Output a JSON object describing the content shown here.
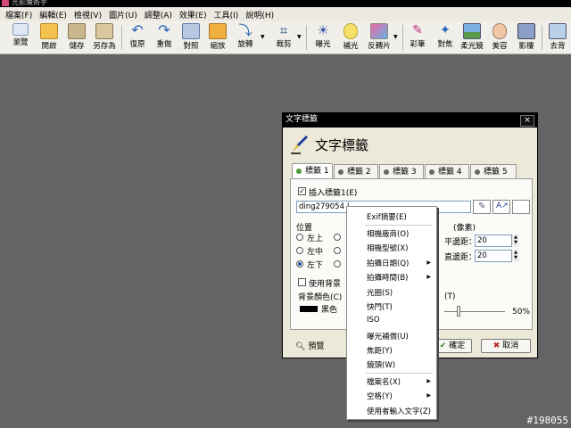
{
  "window": {
    "title": "光影魔術手"
  },
  "menubar": [
    "檔案(F)",
    "編輯(E)",
    "檢視(V)",
    "圖片(U)",
    "調整(A)",
    "效果(E)",
    "工具(I)",
    "說明(H)"
  ],
  "toolbar": {
    "browse": "瀏覽",
    "open": "開啟",
    "save": "儲存",
    "saveas": "另存為",
    "undo": "復原",
    "redo": "重做",
    "compare": "對照",
    "resize": "縮放",
    "rotate": "旋轉",
    "crop": "裁剪",
    "exposure": "曝光",
    "fill_light": "補光",
    "reverse": "反轉片",
    "color_pen": "彩筆",
    "focus": "對焦",
    "soft_lens": "柔光鏡",
    "beauty": "美容",
    "shadow": "影樓",
    "more": "去背"
  },
  "dialog": {
    "title": "文字標籤",
    "heading": "文字標籤",
    "tabs": [
      "標籤 1",
      "標籤 2",
      "標籤 3",
      "標籤 4",
      "標籤 5"
    ],
    "insert_label": "插入標籤1(E)",
    "text_value": "ding279054 |",
    "position_group": "位置",
    "pos_top_left": "左上",
    "pos_mid_left": "左中",
    "pos_bottom_left": "左下",
    "margin_group": "(像素)",
    "h_margin_label": "平邊距：",
    "v_margin_label": "直邊距：",
    "h_margin": "20",
    "v_margin": "20",
    "use_bg": "使用背景",
    "bg_color_label": "背景顏色(C)",
    "bg_color_value": "黑色",
    "opacity_label": "(T)",
    "opacity_value": "50%",
    "preview": "預覽",
    "ok": "確定",
    "cancel": "取消"
  },
  "context_menu": {
    "items": [
      {
        "label": "Exif摘要(E)",
        "sub": false
      },
      {
        "label": "相機廠商(O)",
        "sub": false
      },
      {
        "label": "相機型號(X)",
        "sub": false
      },
      {
        "label": "拍攝日期(Q)",
        "sub": true
      },
      {
        "label": "拍攝時間(B)",
        "sub": true
      },
      {
        "label": "光圈(S)",
        "sub": false
      },
      {
        "label": "快門(T)",
        "sub": false
      },
      {
        "label": "ISO",
        "sub": false
      },
      {
        "label": "曝光補償(U)",
        "sub": false
      },
      {
        "label": "焦距(Y)",
        "sub": false
      },
      {
        "label": "鏡頭(W)",
        "sub": false
      },
      {
        "label": "檔案名(X)",
        "sub": true
      },
      {
        "label": "空格(Y)",
        "sub": true
      },
      {
        "label": "使用者輸入文字(Z)",
        "sub": false
      }
    ]
  },
  "watermark": "#198055"
}
